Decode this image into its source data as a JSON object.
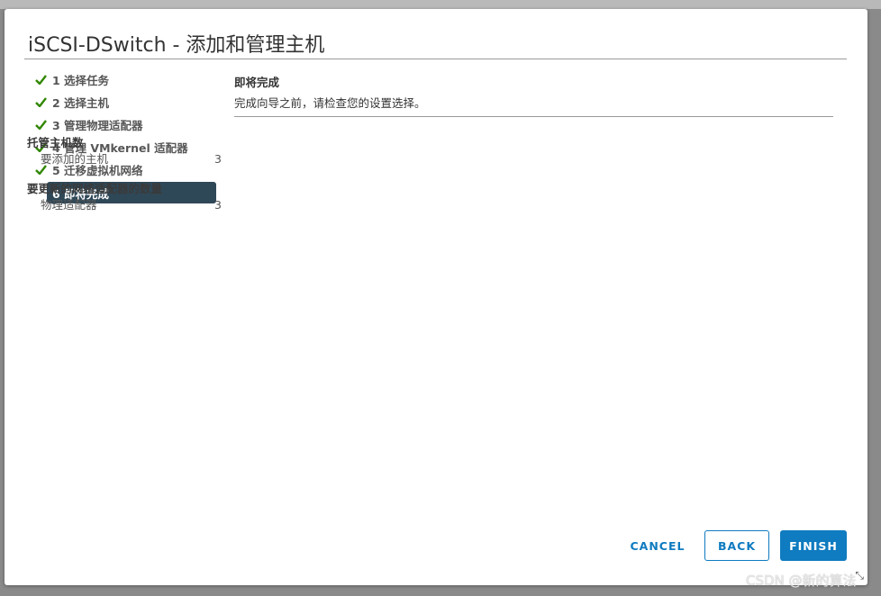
{
  "dialog": {
    "title": "iSCSI-DSwitch - 添加和管理主机"
  },
  "steps": [
    {
      "label": "1 选择任务",
      "done": true
    },
    {
      "label": "2 选择主机",
      "done": true
    },
    {
      "label": "3 管理物理适配器",
      "done": true
    },
    {
      "label": "4 管理 VMkernel 适配器",
      "done": true
    },
    {
      "label": "5 迁移虚拟机网络",
      "done": true
    },
    {
      "label": "6 即将完成",
      "done": false,
      "active": true
    }
  ],
  "content": {
    "heading": "即将完成",
    "subheading": "完成向导之前，请检查您的设置选择。",
    "groups": [
      {
        "title": "托管主机数",
        "rows": [
          {
            "key": "要添加的主机",
            "value": "3"
          }
        ]
      },
      {
        "title": "要更新的网络适配器的数量",
        "rows": [
          {
            "key": "物理适配器",
            "value": "3"
          }
        ]
      }
    ]
  },
  "buttons": {
    "cancel": "CANCEL",
    "back": "BACK",
    "finish": "FINISH"
  },
  "watermark": "CSDN @新的算法",
  "colors": {
    "accent": "#0f7bc0",
    "active_step": "#2f4858",
    "check": "#318700"
  }
}
